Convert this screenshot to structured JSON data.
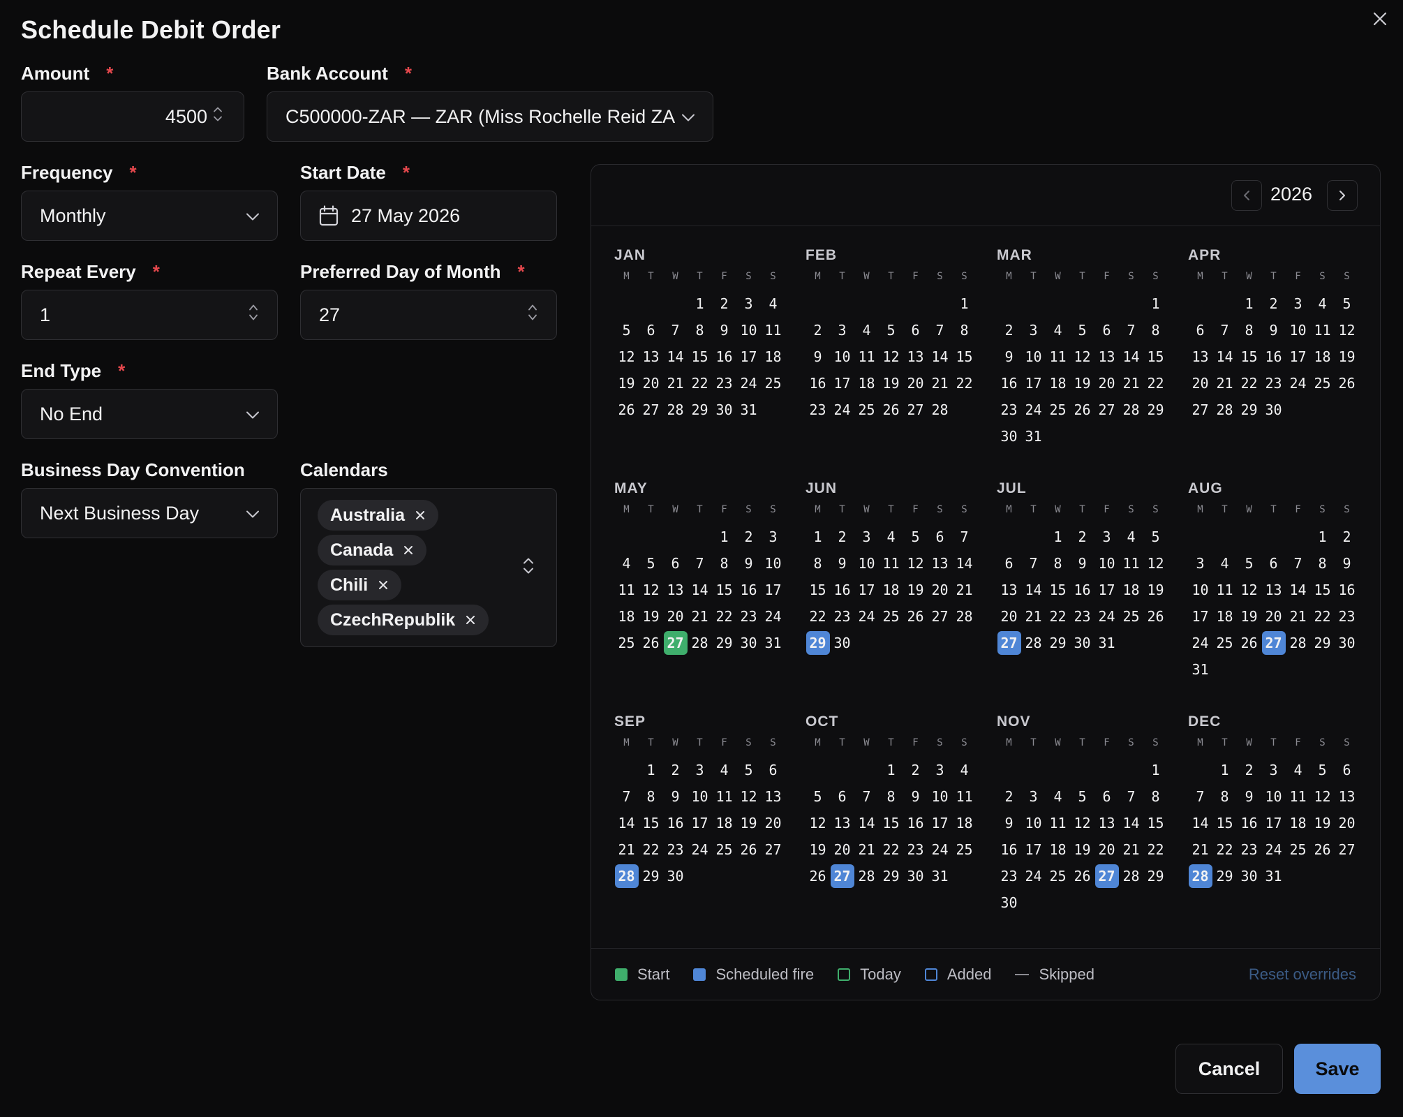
{
  "dialog": {
    "title": "Schedule Debit Order"
  },
  "form": {
    "amount": {
      "label": "Amount",
      "value": "4500"
    },
    "bank_account": {
      "label": "Bank Account",
      "value": "C500000-ZAR — ZAR (Miss Rochelle Reid ZA"
    },
    "frequency": {
      "label": "Frequency",
      "value": "Monthly"
    },
    "start_date": {
      "label": "Start Date",
      "value": "27 May 2026"
    },
    "repeat_every": {
      "label": "Repeat Every",
      "value": "1"
    },
    "preferred_day": {
      "label": "Preferred Day of Month",
      "value": "27"
    },
    "end_type": {
      "label": "End Type",
      "value": "No End"
    },
    "business_day_convention": {
      "label": "Business Day Convention",
      "value": "Next Business Day"
    },
    "calendars": {
      "label": "Calendars",
      "selected": [
        "Australia",
        "Canada",
        "Chili",
        "CzechRepublik"
      ]
    },
    "required_marker": "*"
  },
  "calendar": {
    "year": "2026",
    "weekday_headers": [
      "M",
      "T",
      "W",
      "T",
      "F",
      "S",
      "S"
    ],
    "months": [
      {
        "name": "JAN",
        "offset": 3,
        "days": 31
      },
      {
        "name": "FEB",
        "offset": 6,
        "days": 28
      },
      {
        "name": "MAR",
        "offset": 6,
        "days": 31
      },
      {
        "name": "APR",
        "offset": 2,
        "days": 30
      },
      {
        "name": "MAY",
        "offset": 4,
        "days": 31,
        "start": 27
      },
      {
        "name": "JUN",
        "offset": 0,
        "days": 30,
        "fire": 29
      },
      {
        "name": "JUL",
        "offset": 2,
        "days": 31,
        "fire": 27
      },
      {
        "name": "AUG",
        "offset": 5,
        "days": 31,
        "fire": 27
      },
      {
        "name": "SEP",
        "offset": 1,
        "days": 30,
        "fire": 28
      },
      {
        "name": "OCT",
        "offset": 3,
        "days": 31,
        "fire": 27
      },
      {
        "name": "NOV",
        "offset": 6,
        "days": 30,
        "fire": 27
      },
      {
        "name": "DEC",
        "offset": 1,
        "days": 31,
        "fire": 28
      }
    ],
    "legend": {
      "start": "Start",
      "scheduled": "Scheduled fire",
      "today": "Today",
      "added": "Added",
      "skipped": "Skipped"
    },
    "reset_label": "Reset overrides"
  },
  "actions": {
    "cancel": "Cancel",
    "save": "Save"
  },
  "colors": {
    "start": "#3fae6c",
    "scheduled": "#4f86d6",
    "primary": "#5a8fdb",
    "required": "#e5484d"
  }
}
